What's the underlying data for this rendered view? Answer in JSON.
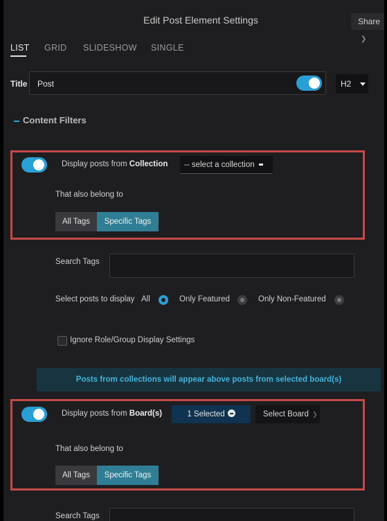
{
  "header": {
    "title": "Edit Post Element Settings",
    "share_label": "Share"
  },
  "tabs": [
    {
      "label": "LIST",
      "active": true
    },
    {
      "label": "GRID",
      "active": false
    },
    {
      "label": "SLIDESHOW",
      "active": false
    },
    {
      "label": "SINGLE",
      "active": false
    }
  ],
  "title_row": {
    "label": "Title",
    "value": "Post",
    "toggle_on": true,
    "heading_level": "H2"
  },
  "content_filters": {
    "title": "Content Filters"
  },
  "collection": {
    "toggle_on": true,
    "label_prefix": "Display posts from ",
    "label_bold": "Collection",
    "select_placeholder": "-- select a collection",
    "belong_label": "That also belong to",
    "tag_options": [
      "All Tags",
      "Specific Tags"
    ],
    "selected_tag_option": "Specific Tags"
  },
  "search_tags": {
    "label": "Search Tags",
    "value": ""
  },
  "display_select": {
    "label": "Select posts to display",
    "options": [
      {
        "label": "All",
        "selected": true
      },
      {
        "label": "Only Featured",
        "selected": false
      },
      {
        "label": "Only Non-Featured",
        "selected": false
      }
    ]
  },
  "ignore_role": {
    "label": "Ignore Role/Group Display Settings",
    "checked": false
  },
  "banner": {
    "text": "Posts from collections will appear above posts from selected board(s)"
  },
  "board": {
    "toggle_on": true,
    "label_prefix": "Display posts from ",
    "label_bold": "Board(s)",
    "selected_label": "1 Selected",
    "select_board_label": "Select Board",
    "belong_label": "That also belong to",
    "tag_options": [
      "All Tags",
      "Specific Tags"
    ],
    "selected_tag_option": "Specific Tags"
  },
  "search_tags_2": {
    "label": "Search Tags"
  },
  "colors": {
    "accent": "#2a9fd6",
    "highlight_border": "#c44a48",
    "banner_bg": "#173440",
    "banner_text": "#43b2d8"
  }
}
